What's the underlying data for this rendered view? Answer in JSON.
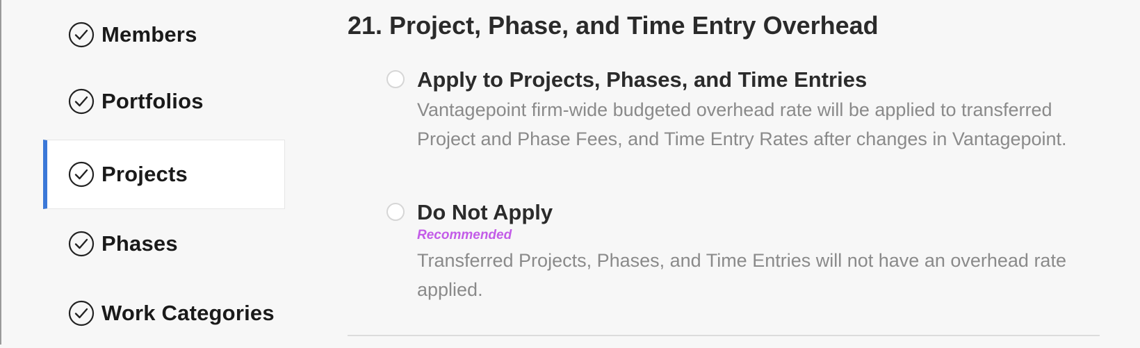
{
  "sidebar": {
    "items": [
      {
        "label": "Members",
        "icon": "check-circle-icon",
        "active": false
      },
      {
        "label": "Portfolios",
        "icon": "check-circle-icon",
        "active": false
      },
      {
        "label": "Projects",
        "icon": "check-circle-icon",
        "active": true
      },
      {
        "label": "Phases",
        "icon": "check-circle-icon",
        "active": false
      },
      {
        "label": "Work Categories",
        "icon": "check-circle-icon",
        "active": false
      }
    ]
  },
  "section": {
    "number": "21.",
    "title": "Project, Phase, and Time Entry Overhead",
    "options": [
      {
        "title": "Apply to Projects, Phases, and Time Entries",
        "tag": "",
        "description": "Vantagepoint firm-wide budgeted overhead rate will be applied to transferred Project and Phase Fees, and Time Entry Rates after changes in Vantagepoint.",
        "selected": false
      },
      {
        "title": "Do Not Apply",
        "tag": "Recommended",
        "description": "Transferred Projects, Phases, and Time Entries will not have an overhead rate applied.",
        "selected": false
      }
    ]
  },
  "colors": {
    "active_indicator": "#3b78d8",
    "recommended": "#c35ce8",
    "description_text": "#8a8a8a"
  }
}
